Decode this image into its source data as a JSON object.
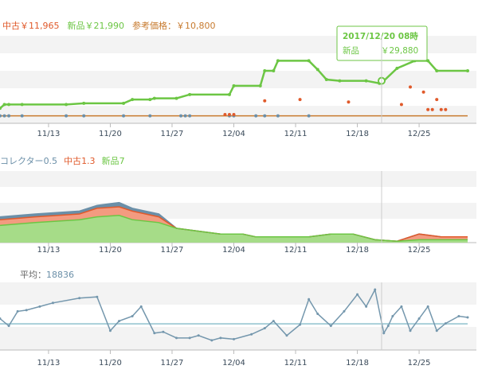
{
  "colors": {
    "used": "#e05a2b",
    "used_fill": "#f39b80",
    "new": "#6cc644",
    "new_fill": "#a6dc88",
    "collector": "#6b8fa8",
    "reference": "#c77a2e",
    "sales": "#7497ad",
    "average": "#a8cfd9",
    "label_gray": "#666666",
    "tooltip_date": "#6cc644"
  },
  "x_labels": [
    "11/13",
    "11/20",
    "11/27",
    "12/04",
    "12/11",
    "12/18",
    "12/25"
  ],
  "chart_data": [
    {
      "type": "line",
      "legend": {
        "used_label": "中古",
        "used_value": "￥11,965",
        "new_label": "新品",
        "new_value": "￥21,990",
        "ref_label": "参考価格：",
        "ref_value": "￥10,800"
      },
      "x_unit": "day index (0 = 11/8)",
      "ylim": [
        5000,
        40000
      ],
      "series": [
        {
          "name": "新品",
          "points": [
            [
              0,
              11000
            ],
            [
              1,
              12500
            ],
            [
              2,
              12500
            ],
            [
              5,
              12500
            ],
            [
              15,
              12500
            ],
            [
              19,
              13000
            ],
            [
              28,
              13000
            ],
            [
              30,
              14500
            ],
            [
              34,
              14500
            ],
            [
              35,
              15000
            ],
            [
              40,
              15000
            ],
            [
              43,
              16500
            ],
            [
              52,
              16500
            ],
            [
              53,
              20000
            ],
            [
              59,
              20000
            ],
            [
              60,
              26000
            ],
            [
              62,
              26000
            ],
            [
              63,
              30000
            ],
            [
              70,
              30000
            ],
            [
              72,
              26500
            ],
            [
              74,
              22500
            ],
            [
              77,
              22000
            ],
            [
              83,
              22000
            ],
            [
              86,
              21000
            ],
            [
              87,
              21990
            ],
            [
              90,
              27000
            ],
            [
              94,
              30000
            ],
            [
              97,
              30000
            ],
            [
              99,
              26000
            ],
            [
              106,
              26000
            ]
          ]
        },
        {
          "name": "中古",
          "points": [
            [
              0,
              8000
            ],
            [
              1,
              8000
            ],
            [
              2,
              8000
            ],
            [
              5,
              8000
            ],
            [
              15,
              8000
            ],
            [
              19,
              8000
            ],
            [
              28,
              8000
            ],
            [
              34,
              8000
            ],
            [
              41,
              8000
            ],
            [
              42,
              8000
            ],
            [
              43,
              8000
            ],
            [
              52,
              8000
            ],
            [
              53,
              8000
            ],
            [
              58,
              8000
            ],
            [
              60,
              8000
            ],
            [
              63,
              8000
            ],
            [
              70,
              8000
            ],
            [
              72,
              8000
            ],
            [
              74,
              8000
            ],
            [
              77,
              8000
            ],
            [
              83,
              8000
            ],
            [
              86,
              8000
            ],
            [
              87,
              8000
            ],
            [
              90,
              8000
            ],
            [
              94,
              8000
            ],
            [
              97,
              8000
            ],
            [
              99,
              8000
            ],
            [
              106,
              8000
            ]
          ]
        },
        {
          "name": "参考価格",
          "points": [
            [
              0,
              8000
            ],
            [
              106,
              8000
            ]
          ]
        }
      ],
      "scatter": [
        [
          51,
          8500
        ],
        [
          52,
          8500
        ],
        [
          53,
          8500
        ],
        [
          60,
          14000
        ],
        [
          68,
          14500
        ],
        [
          79,
          13500
        ],
        [
          91,
          12500
        ],
        [
          93,
          19500
        ],
        [
          96,
          17500
        ],
        [
          97,
          10500
        ],
        [
          98,
          10500
        ],
        [
          99,
          14500
        ],
        [
          100,
          10500
        ],
        [
          101,
          10500
        ]
      ],
      "tooltip": {
        "date": "2017/12/20 08時",
        "label": "新品",
        "value": "￥29,880"
      }
    },
    {
      "type": "area",
      "legend": {
        "collector_label": "コレクター",
        "collector_value": "0.5",
        "used_label": "中古",
        "used_value": "1.3",
        "new_label": "新品",
        "new_value": "7"
      },
      "ylim": [
        0,
        25
      ],
      "series": [
        {
          "name": "新品",
          "points": [
            [
              0,
              6
            ],
            [
              8,
              7
            ],
            [
              18,
              8
            ],
            [
              22,
              9
            ],
            [
              27,
              9.5
            ],
            [
              30,
              8
            ],
            [
              36,
              7
            ],
            [
              40,
              5
            ],
            [
              45,
              4
            ],
            [
              50,
              3
            ],
            [
              55,
              3
            ],
            [
              58,
              2
            ],
            [
              64,
              2
            ],
            [
              70,
              2
            ],
            [
              75,
              3
            ],
            [
              80,
              3
            ],
            [
              85,
              1
            ],
            [
              90,
              0.5
            ],
            [
              95,
              1
            ],
            [
              100,
              1
            ],
            [
              106,
              1
            ]
          ]
        },
        {
          "name": "中古",
          "points": [
            [
              0,
              8
            ],
            [
              8,
              9
            ],
            [
              18,
              10
            ],
            [
              22,
              12
            ],
            [
              27,
              12.5
            ],
            [
              30,
              11
            ],
            [
              36,
              9
            ],
            [
              40,
              5
            ],
            [
              45,
              4
            ],
            [
              50,
              3
            ],
            [
              55,
              3
            ],
            [
              58,
              2
            ],
            [
              64,
              2
            ],
            [
              70,
              2
            ],
            [
              75,
              3
            ],
            [
              80,
              3
            ],
            [
              85,
              1
            ],
            [
              90,
              0.5
            ],
            [
              95,
              3
            ],
            [
              100,
              2
            ],
            [
              106,
              2
            ]
          ]
        },
        {
          "name": "コレクター",
          "points": [
            [
              0,
              9
            ],
            [
              8,
              10
            ],
            [
              18,
              11
            ],
            [
              22,
              13
            ],
            [
              27,
              14
            ],
            [
              30,
              12
            ],
            [
              36,
              10
            ],
            [
              40,
              5
            ],
            [
              45,
              4
            ],
            [
              50,
              3
            ],
            [
              55,
              3
            ],
            [
              58,
              2
            ],
            [
              64,
              2
            ],
            [
              70,
              2
            ],
            [
              75,
              3
            ],
            [
              80,
              3
            ],
            [
              85,
              1
            ],
            [
              90,
              0.5
            ],
            [
              95,
              3
            ],
            [
              100,
              2
            ],
            [
              106,
              2
            ]
          ]
        }
      ]
    },
    {
      "type": "line",
      "legend": {
        "avg_label": "平均：",
        "avg_value": "18836"
      },
      "series": [
        {
          "name": "sales",
          "points": [
            [
              0,
              21000
            ],
            [
              2,
              18000
            ],
            [
              4,
              24000
            ],
            [
              6,
              24500
            ],
            [
              9,
              26000
            ],
            [
              12,
              27500
            ],
            [
              18,
              29500
            ],
            [
              22,
              30000
            ],
            [
              25,
              16000
            ],
            [
              27,
              20000
            ],
            [
              30,
              22000
            ],
            [
              32,
              26000
            ],
            [
              35,
              15000
            ],
            [
              37,
              15500
            ],
            [
              40,
              13000
            ],
            [
              43,
              13000
            ],
            [
              45,
              14000
            ],
            [
              48,
              12000
            ],
            [
              50,
              13000
            ],
            [
              53,
              12500
            ],
            [
              57,
              14500
            ],
            [
              60,
              17000
            ],
            [
              62,
              20000
            ],
            [
              65,
              14000
            ],
            [
              68,
              18500
            ],
            [
              70,
              29000
            ],
            [
              72,
              23000
            ],
            [
              75,
              18000
            ],
            [
              78,
              24000
            ],
            [
              81,
              31000
            ],
            [
              83,
              26000
            ],
            [
              85,
              33000
            ],
            [
              87,
              15000
            ],
            [
              88,
              18000
            ],
            [
              89,
              22000
            ],
            [
              91,
              26000
            ],
            [
              93,
              16000
            ],
            [
              95,
              21000
            ],
            [
              97,
              26000
            ],
            [
              99,
              16000
            ],
            [
              101,
              19000
            ],
            [
              104,
              22000
            ],
            [
              106,
              21500
            ]
          ]
        },
        {
          "name": "平均",
          "points": [
            [
              0,
              18836
            ],
            [
              106,
              18836
            ]
          ]
        }
      ]
    }
  ]
}
